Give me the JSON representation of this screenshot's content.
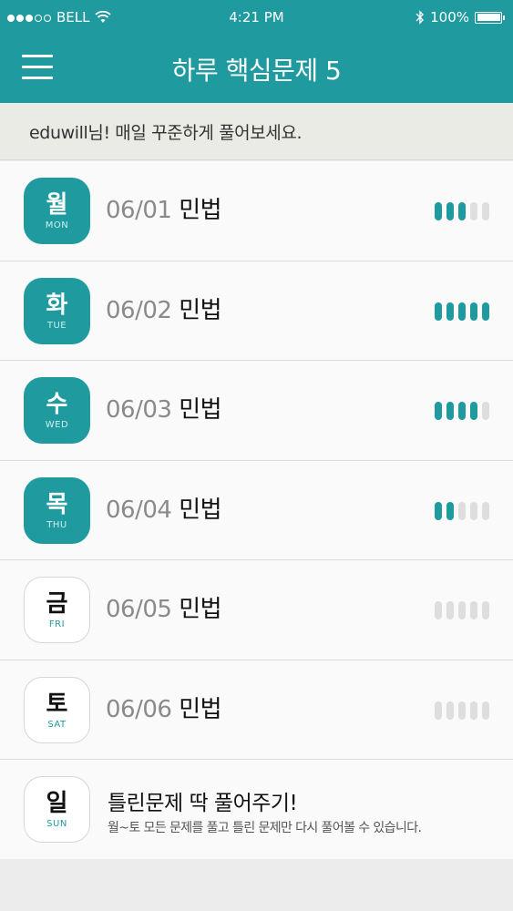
{
  "status_bar": {
    "carrier": "BELL",
    "time": "4:21 PM",
    "battery": "100%",
    "signal_dots": [
      true,
      true,
      true,
      false,
      false
    ]
  },
  "header": {
    "title": "하루 핵심문제 5",
    "menu_icon": "hamburger-menu-icon"
  },
  "greeting": "eduwill님! 매일 꾸준하게 풀어보세요.",
  "colors": {
    "accent": "#1f9a9f",
    "bar_empty": "#dedede"
  },
  "days": [
    {
      "kr": "월",
      "en": "MON",
      "date": "06/01",
      "subject": "민법",
      "active": true,
      "progress": 3,
      "total": 5
    },
    {
      "kr": "화",
      "en": "TUE",
      "date": "06/02",
      "subject": "민법",
      "active": true,
      "progress": 5,
      "total": 5
    },
    {
      "kr": "수",
      "en": "WED",
      "date": "06/03",
      "subject": "민법",
      "active": true,
      "progress": 4,
      "total": 5
    },
    {
      "kr": "목",
      "en": "THU",
      "date": "06/04",
      "subject": "민법",
      "active": true,
      "progress": 2,
      "total": 5
    },
    {
      "kr": "금",
      "en": "FRI",
      "date": "06/05",
      "subject": "민법",
      "active": false,
      "progress": 0,
      "total": 5
    },
    {
      "kr": "토",
      "en": "SAT",
      "date": "06/06",
      "subject": "민법",
      "active": false,
      "progress": 0,
      "total": 5
    }
  ],
  "review": {
    "kr": "일",
    "en": "SUN",
    "title": "틀린문제 딱 풀어주기!",
    "description": "월~토 모든 문제를 풀고 틀린 문제만 다시 풀어볼 수 있습니다."
  }
}
